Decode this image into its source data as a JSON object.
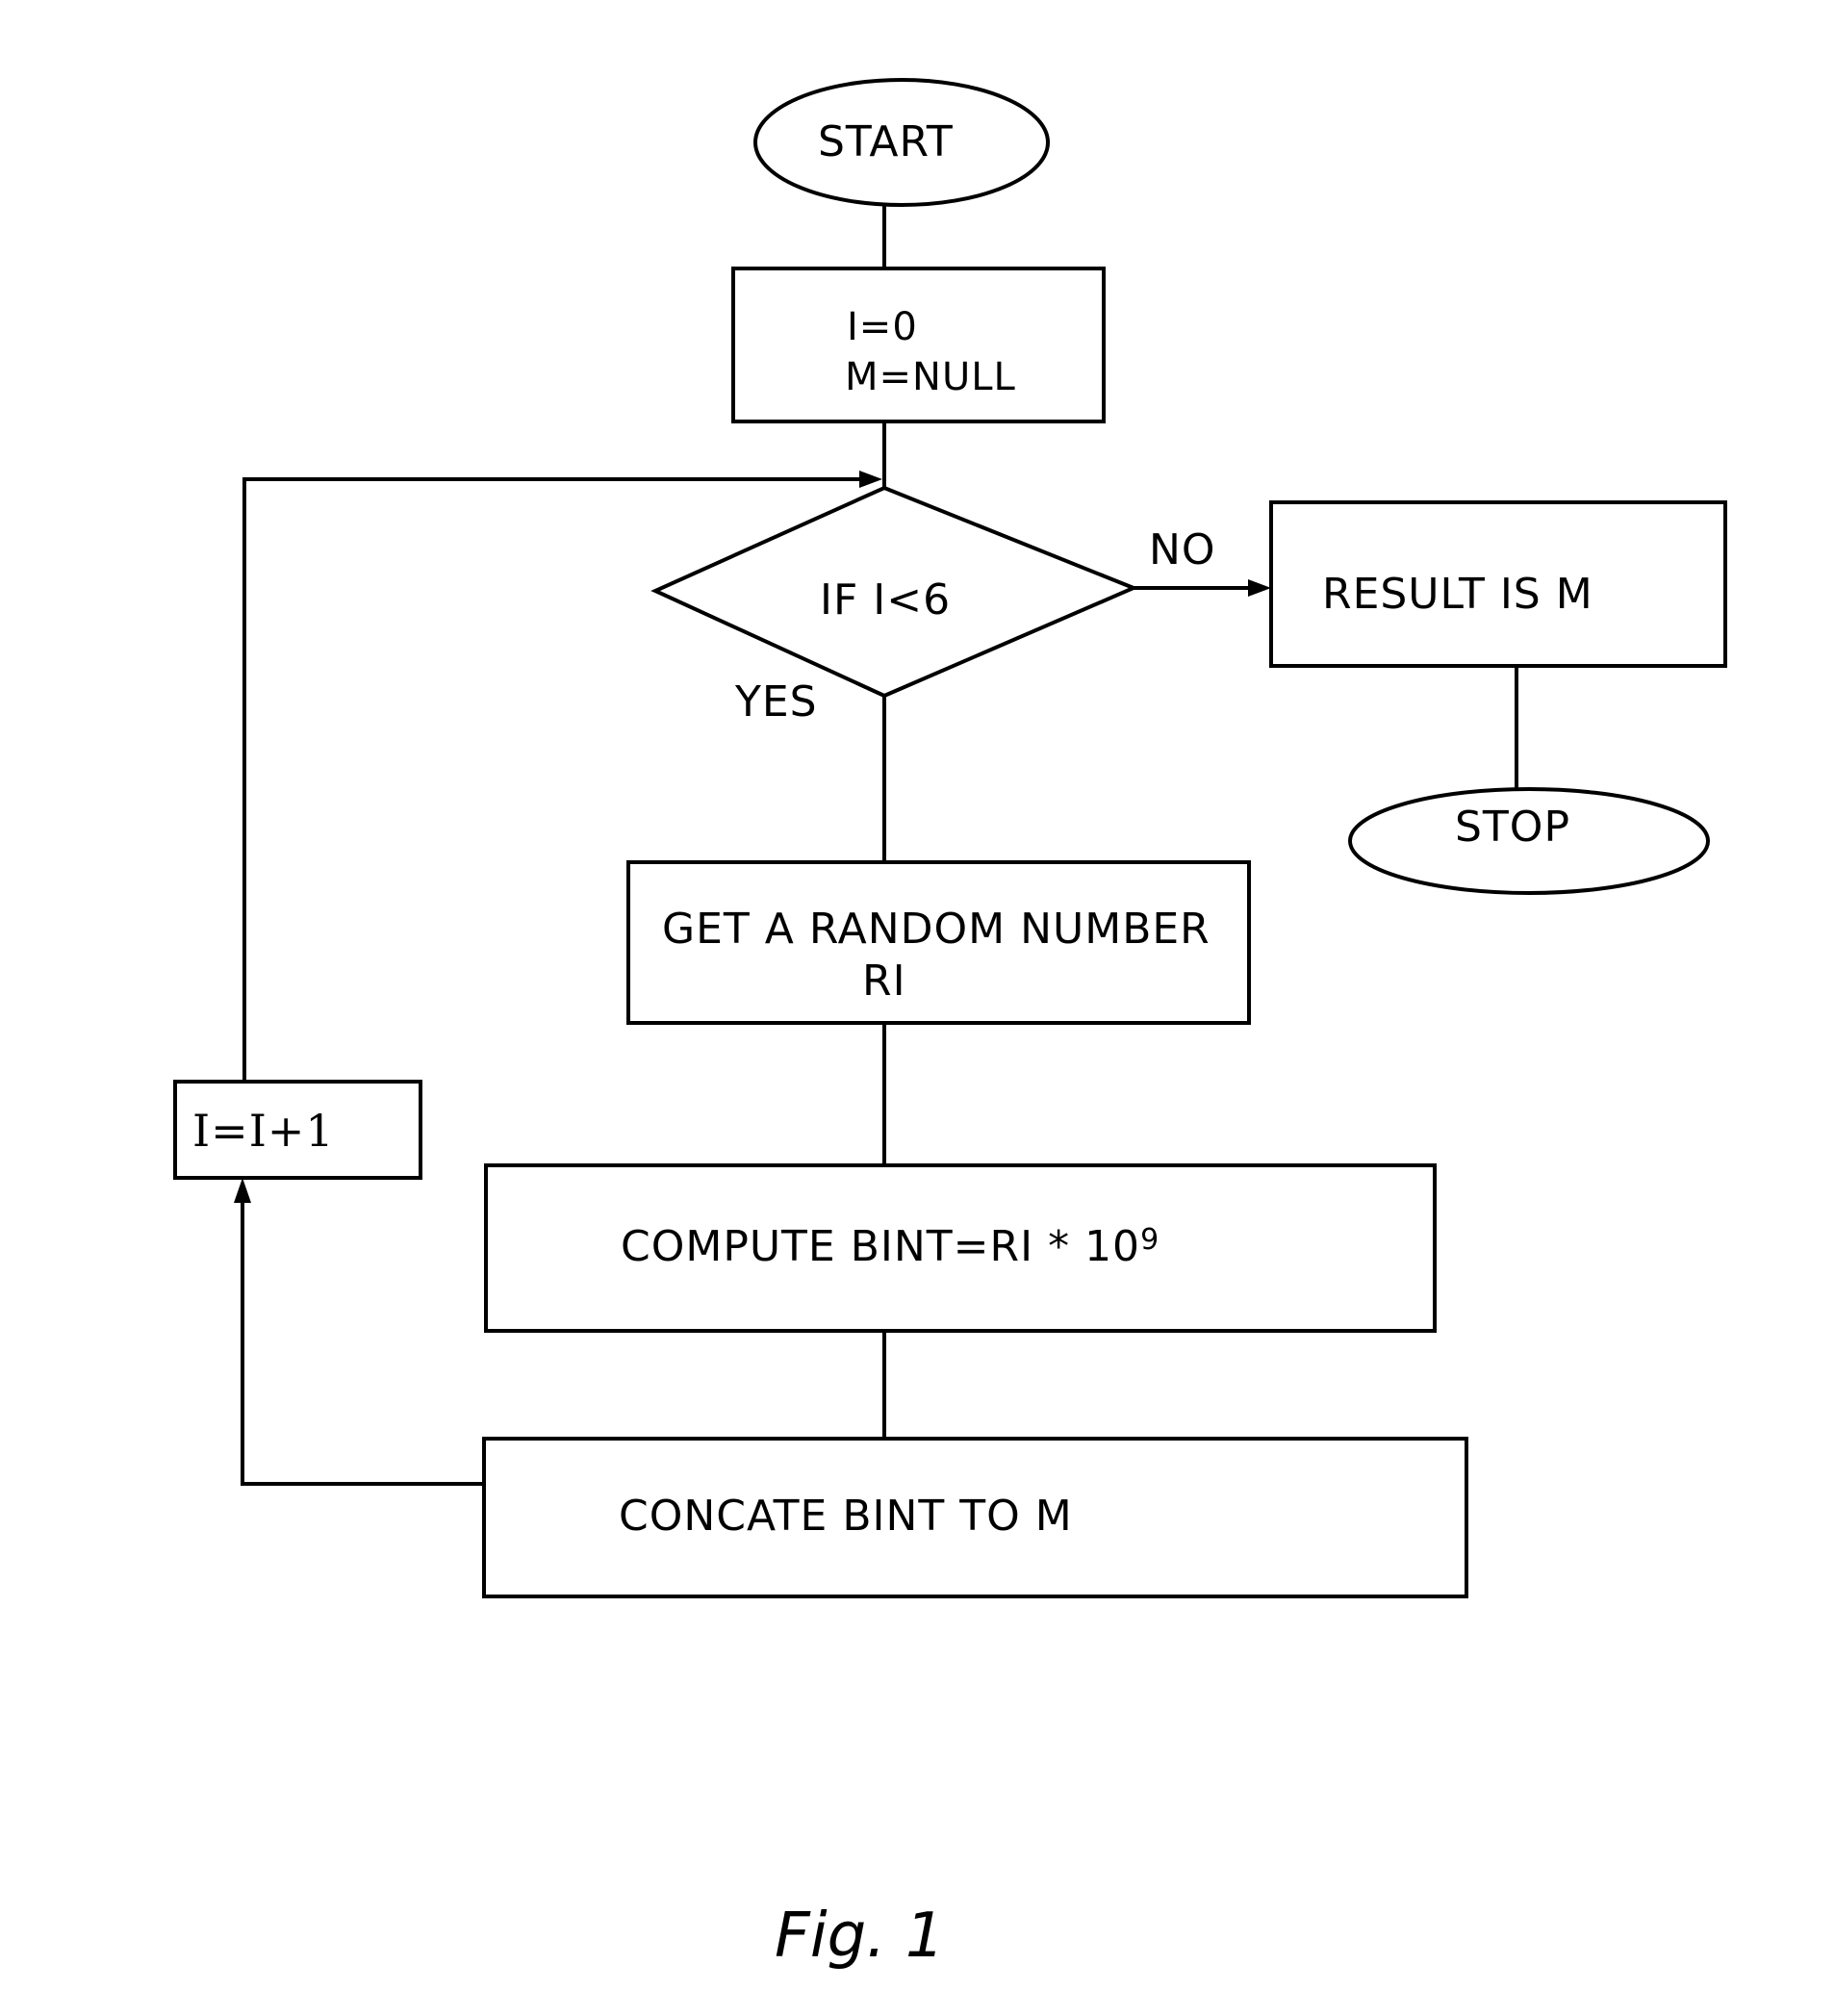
{
  "figure": {
    "caption": "Fig. 1",
    "nodes": {
      "start": {
        "type": "terminal",
        "label": "START"
      },
      "init": {
        "type": "process",
        "line1": "I=0",
        "line2": "M=NULL"
      },
      "decision": {
        "type": "decision",
        "label": "IF  I<6"
      },
      "result": {
        "type": "process",
        "label": "RESULT IS  M"
      },
      "stop": {
        "type": "terminal",
        "label": "STOP"
      },
      "random": {
        "type": "process",
        "line1": "GET A RANDOM NUMBER",
        "line2": "RI"
      },
      "compute": {
        "type": "process",
        "label": "COMPUTE   BINT=RI * 10",
        "exponent": "9"
      },
      "concat": {
        "type": "process",
        "label": "CONCATE BINT TO M"
      },
      "increment": {
        "type": "process",
        "label": "I=I+1"
      }
    },
    "edge_labels": {
      "no": "NO",
      "yes": "YES"
    },
    "edges": [
      {
        "from": "start",
        "to": "init"
      },
      {
        "from": "init",
        "to": "decision"
      },
      {
        "from": "decision",
        "to": "result",
        "label": "NO"
      },
      {
        "from": "result",
        "to": "stop"
      },
      {
        "from": "decision",
        "to": "random",
        "label": "YES"
      },
      {
        "from": "random",
        "to": "compute"
      },
      {
        "from": "compute",
        "to": "concat"
      },
      {
        "from": "concat",
        "to": "increment"
      },
      {
        "from": "increment",
        "to": "decision"
      }
    ]
  }
}
